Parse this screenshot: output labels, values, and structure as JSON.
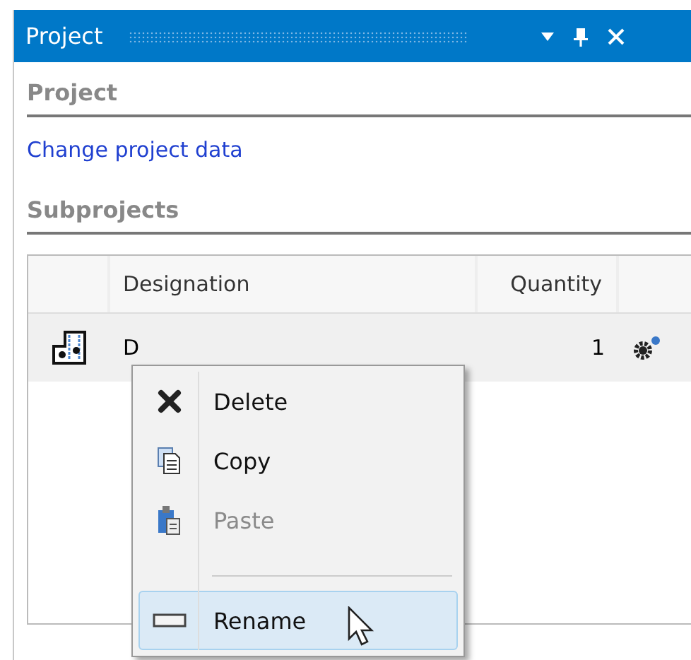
{
  "window": {
    "title": "Project"
  },
  "sections": [
    {
      "heading": "Project",
      "link": "Change project data"
    },
    {
      "heading": "Subprojects"
    }
  ],
  "table": {
    "columns": [
      "Designation",
      "Quantity"
    ],
    "rows": [
      {
        "designation": "D",
        "quantity": "1"
      }
    ]
  },
  "context_menu": [
    {
      "kind": "item",
      "label": "Delete",
      "disabled": false,
      "selected": false
    },
    {
      "kind": "item",
      "label": "Copy",
      "disabled": false,
      "selected": false
    },
    {
      "kind": "item",
      "label": "Paste",
      "disabled": true,
      "selected": false
    },
    {
      "kind": "separator"
    },
    {
      "kind": "item",
      "label": "Rename",
      "disabled": false,
      "selected": true
    }
  ]
}
